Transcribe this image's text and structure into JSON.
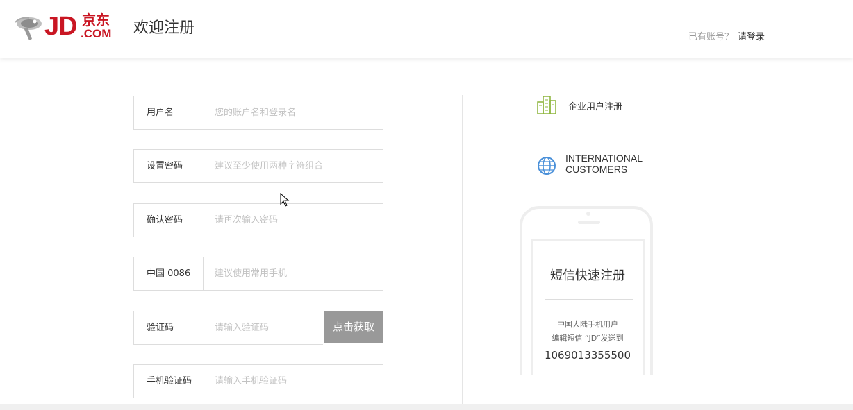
{
  "header": {
    "logo_jd": "JD",
    "logo_cn": "京东",
    "logo_com": ".COM",
    "title": "欢迎注册",
    "login_prompt": "已有账号？",
    "login_link": "请登录"
  },
  "form": {
    "username": {
      "label": "用户名",
      "placeholder": "您的账户名和登录名"
    },
    "password": {
      "label": "设置密码",
      "placeholder": "建议至少使用两种字符组合"
    },
    "confirm": {
      "label": "确认密码",
      "placeholder": "请再次输入密码"
    },
    "phone": {
      "label": "中国 0086",
      "placeholder": "建议使用常用手机"
    },
    "captcha": {
      "label": "验证码",
      "placeholder": "请输入验证码",
      "button": "点击获取"
    },
    "sms_code": {
      "label": "手机验证码",
      "placeholder": "请输入手机验证码"
    }
  },
  "side": {
    "enterprise": "企业用户注册",
    "international_line1": "INTERNATIONAL",
    "international_line2": "CUSTOMERS",
    "sms_title": "短信快速注册",
    "sms_line1": "中国大陆手机用户",
    "sms_line2": "编辑短信 “JD”发送到",
    "sms_number": "1069013355500"
  },
  "colors": {
    "brand": "#c91623",
    "button": "#999999",
    "icon_green": "#8bb439",
    "icon_blue": "#4a90d9"
  }
}
